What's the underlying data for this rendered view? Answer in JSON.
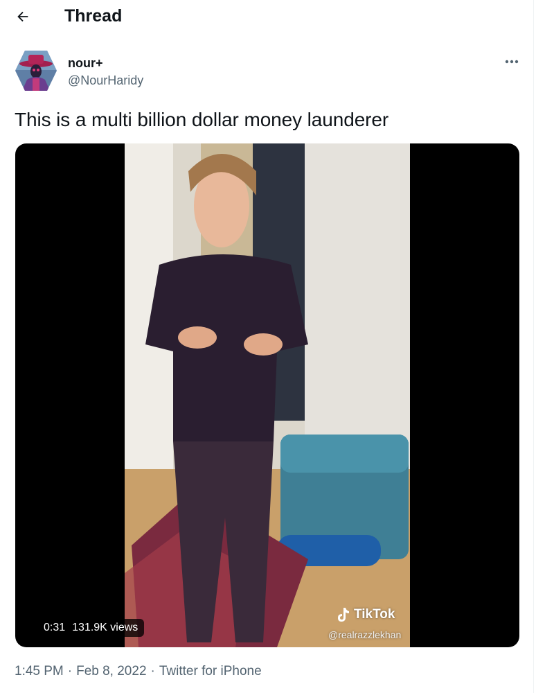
{
  "header": {
    "title": "Thread"
  },
  "tweet": {
    "author_name": "nour+",
    "author_handle": "@NourHaridy",
    "text": "This is a multi billion dollar money launderer",
    "video": {
      "duration": "0:31",
      "views": "131.9K views",
      "watermark_brand": "TikTok",
      "watermark_handle": "@realrazzlekhan"
    },
    "time": "1:45 PM",
    "separator": "·",
    "date": "Feb 8, 2022",
    "source": "Twitter for iPhone"
  },
  "icons": {
    "back": "arrow-left-icon",
    "more": "more-horizontal-icon"
  },
  "colors": {
    "text": "#0f1419",
    "secondary": "#536471",
    "video_bg": "#000000"
  }
}
